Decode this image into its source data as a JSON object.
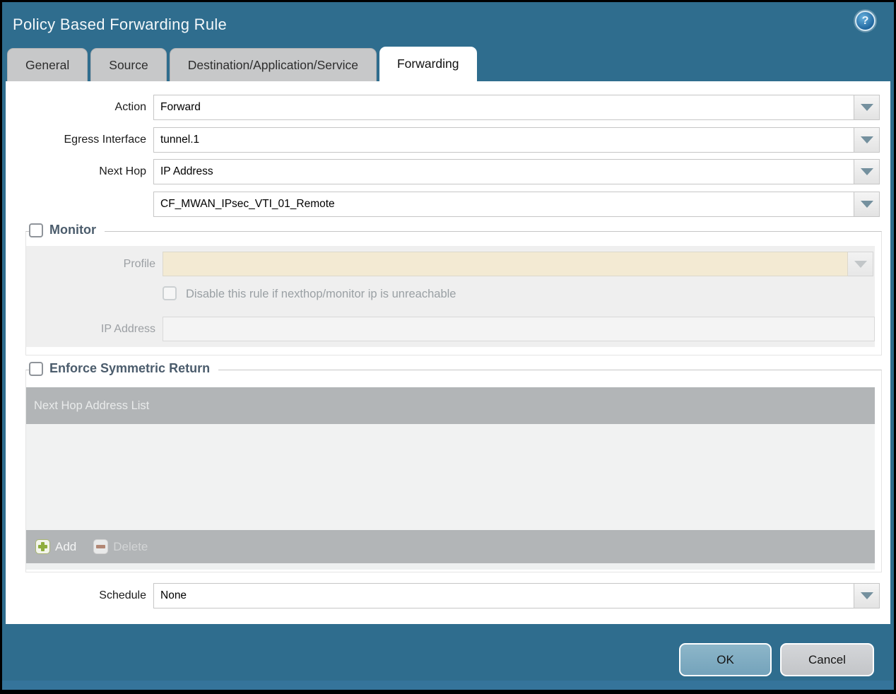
{
  "dialog": {
    "title": "Policy Based Forwarding Rule",
    "help_glyph": "?"
  },
  "tabs": [
    {
      "label": "General",
      "active": false
    },
    {
      "label": "Source",
      "active": false
    },
    {
      "label": "Destination/Application/Service",
      "active": false
    },
    {
      "label": "Forwarding",
      "active": true
    }
  ],
  "fields": {
    "action": {
      "label": "Action",
      "value": "Forward"
    },
    "egress_interface": {
      "label": "Egress Interface",
      "value": "tunnel.1"
    },
    "next_hop": {
      "label": "Next Hop",
      "value": "IP Address"
    },
    "next_hop_address": {
      "value": "CF_MWAN_IPsec_VTI_01_Remote"
    },
    "schedule": {
      "label": "Schedule",
      "value": "None"
    }
  },
  "monitor": {
    "legend": "Monitor",
    "checked": false,
    "profile": {
      "label": "Profile",
      "value": "",
      "disabled": true
    },
    "disable_rule": {
      "label": "Disable this rule if nexthop/monitor ip is unreachable",
      "checked": false,
      "disabled": true
    },
    "ip_address": {
      "label": "IP Address",
      "value": "",
      "disabled": true
    }
  },
  "symmetric_return": {
    "legend": "Enforce Symmetric Return",
    "checked": false,
    "table": {
      "header": "Next Hop Address List",
      "rows": []
    },
    "add_label": "Add",
    "delete_label": "Delete",
    "delete_disabled": true
  },
  "footer": {
    "ok_label": "OK",
    "cancel_label": "Cancel"
  },
  "colors": {
    "chrome_teal": "#2f6d8e",
    "bottom_strip": "#35749b",
    "ok_button": "#7dacc2",
    "cancel_button": "#cbcdd0",
    "tab_inactive": "#c7c8c9",
    "legend_text": "#4b5c6c",
    "table_gray": "#b2b5b7",
    "profile_field_cream": "#f3ead3",
    "add_plus_green": "#8fae3e",
    "delete_minus_red": "#b28775",
    "dropdown_arrow": "#74909e"
  }
}
